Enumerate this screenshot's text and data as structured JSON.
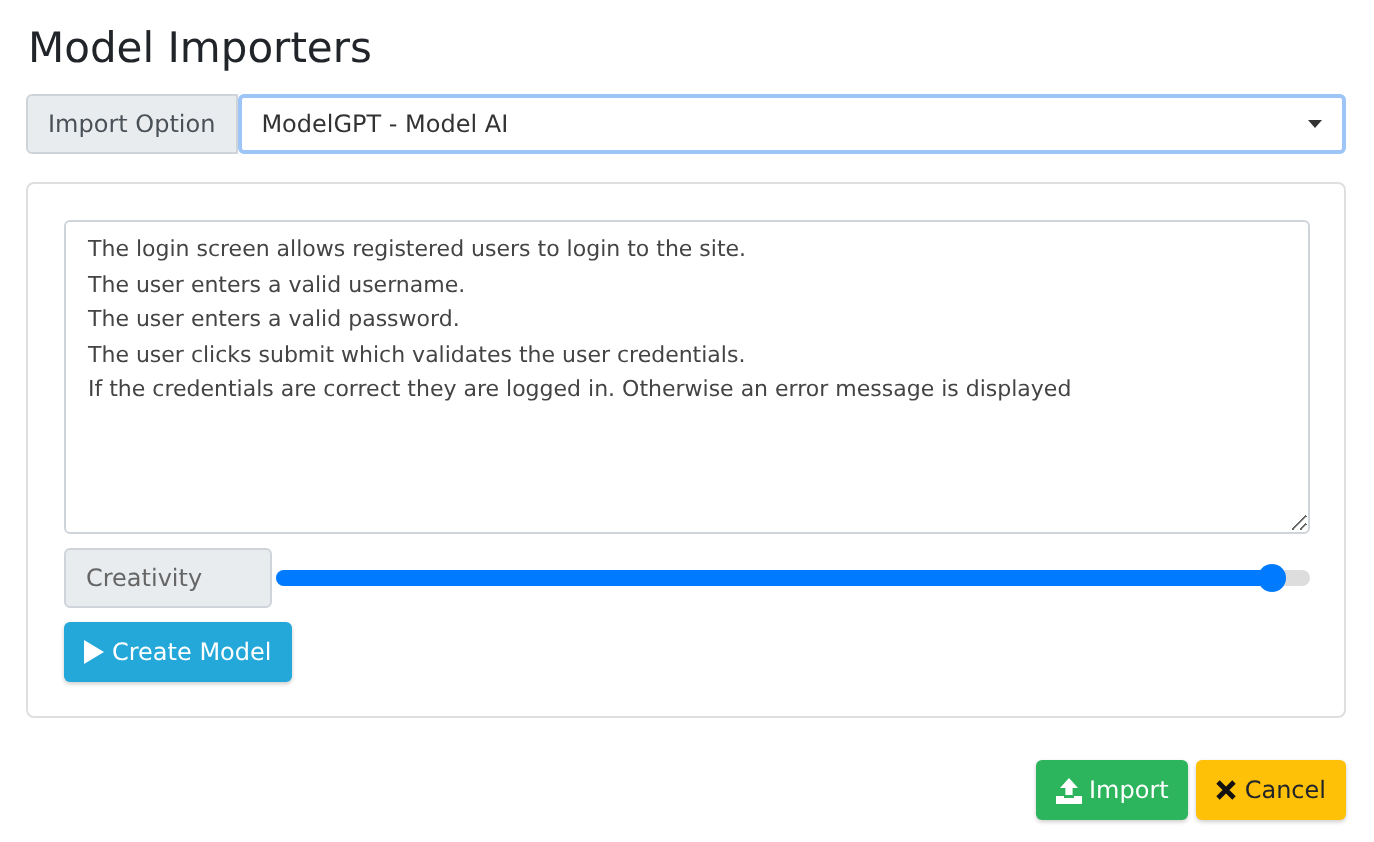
{
  "title": "Model Importers",
  "import_option": {
    "label": "Import Option",
    "value": "ModelGPT - Model AI"
  },
  "description": {
    "lines": [
      "The login screen allows registered users to login to the site.",
      "The user enters a valid username.",
      "The user enters a valid password.",
      "The user clicks submit which validates the user credentials.",
      "If the credentials are correct they are logged in. Otherwise an error message is displayed"
    ]
  },
  "creativity": {
    "label": "Creativity",
    "level": 0.965
  },
  "create_button": {
    "label": "Create Model",
    "kind": "play"
  },
  "footer_buttons": [
    {
      "label": "Import",
      "kind": "import"
    },
    {
      "label": "Cancel",
      "kind": "cancel"
    }
  ]
}
